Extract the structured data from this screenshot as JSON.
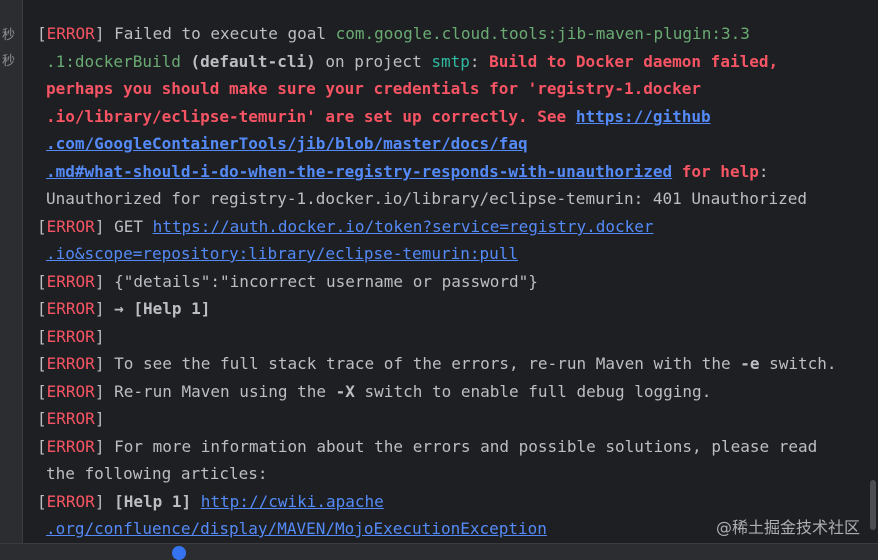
{
  "gutter": {
    "marks": [
      "秒",
      "秒"
    ]
  },
  "console": {
    "l1": {
      "b1": "[",
      "tag": "ERROR",
      "b2": "] ",
      "text": "Failed to execute goal ",
      "plugin": "com.google.cloud.tools:jib-maven-plugin:3.3"
    },
    "l2": {
      "plugin": ".1:dockerBuild",
      "sp": " ",
      "cli": "(default-cli)",
      "mid": " on project ",
      "project": "smtp",
      "colon": ": ",
      "msg": "Build to Docker daemon failed,"
    },
    "l3": {
      "msg": "perhaps you should make sure your credentials for 'registry-1.docker"
    },
    "l4": {
      "msg": ".io/library/eclipse-temurin' are set up correctly. See ",
      "link": "https://github"
    },
    "l5": {
      "link": ".com/GoogleContainerTools/jib/blob/master/docs/faq"
    },
    "l6": {
      "link": ".md#what-should-i-do-when-the-registry-responds-with-unauthorized",
      "help": " for help",
      "colon": ":"
    },
    "l7": {
      "text": "Unauthorized for registry-1.docker.io/library/eclipse-temurin: 401 Unauthorized"
    },
    "l8": {
      "b1": "[",
      "tag": "ERROR",
      "b2": "] ",
      "text": "GET ",
      "link": "https://auth.docker.io/token?service=registry.docker"
    },
    "l9": {
      "link": ".io&scope=repository:library/eclipse-temurin:pull"
    },
    "l10": {
      "b1": "[",
      "tag": "ERROR",
      "b2": "] ",
      "text": "{\"details\":\"incorrect username or password\"}"
    },
    "l11": {
      "b1": "[",
      "tag": "ERROR",
      "b2": "] ",
      "text": "→ [Help 1]"
    },
    "l12": {
      "b1": "[",
      "tag": "ERROR",
      "b2": "]"
    },
    "l13": {
      "b1": "[",
      "tag": "ERROR",
      "b2": "] ",
      "text": "To see the full stack trace of the errors, re-run Maven with the ",
      "opt": "-e",
      "tail": " switch."
    },
    "l14": {
      "b1": "[",
      "tag": "ERROR",
      "b2": "] ",
      "text": "Re-run Maven using the ",
      "opt": "-X",
      "tail": " switch to enable full debug logging."
    },
    "l15": {
      "b1": "[",
      "tag": "ERROR",
      "b2": "]"
    },
    "l16": {
      "b1": "[",
      "tag": "ERROR",
      "b2": "] ",
      "text": "For more information about the errors and possible solutions, please read"
    },
    "l17": {
      "text": "the following articles:"
    },
    "l18": {
      "b1": "[",
      "tag": "ERROR",
      "b2": "] ",
      "help": "[Help 1]",
      "sp": " ",
      "link": "http://cwiki.apache"
    },
    "l19": {
      "link": ".org/confluence/display/MAVEN/MojoExecutionException"
    }
  },
  "watermark": "@稀土掘金技术社区"
}
